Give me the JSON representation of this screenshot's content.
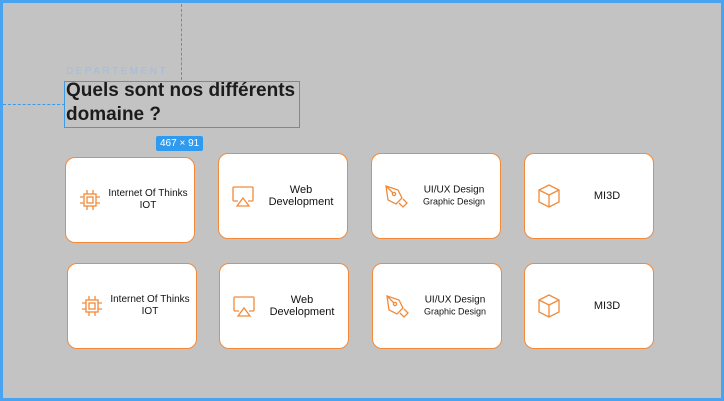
{
  "section": {
    "eyebrow": "DEPARTEMENT",
    "title_line1": "Quels sont nos différents",
    "title_line2": "domaine ?",
    "selection_size": "467 × 91"
  },
  "colors": {
    "accent": "#f28a3a",
    "background": "#c3c3c3",
    "selection": "#2f9bf0"
  },
  "rows": [
    {
      "cards": [
        {
          "icon": "chip-icon",
          "line1": "Internet Of Thinks",
          "line2": "IOT"
        },
        {
          "icon": "monitor-icon",
          "line1": "Web Development",
          "line2": ""
        },
        {
          "icon": "pen-icon",
          "line1": "UI/UX Design",
          "line2": "Graphic Design"
        },
        {
          "icon": "cube-icon",
          "line1": "MI3D",
          "line2": ""
        }
      ]
    },
    {
      "cards": [
        {
          "icon": "chip-icon",
          "line1": "Internet Of Thinks",
          "line2": "IOT"
        },
        {
          "icon": "monitor-icon",
          "line1": "Web Development",
          "line2": ""
        },
        {
          "icon": "pen-icon",
          "line1": "UI/UX Design",
          "line2": "Graphic Design"
        },
        {
          "icon": "cube-icon",
          "line1": "MI3D",
          "line2": ""
        }
      ]
    }
  ]
}
